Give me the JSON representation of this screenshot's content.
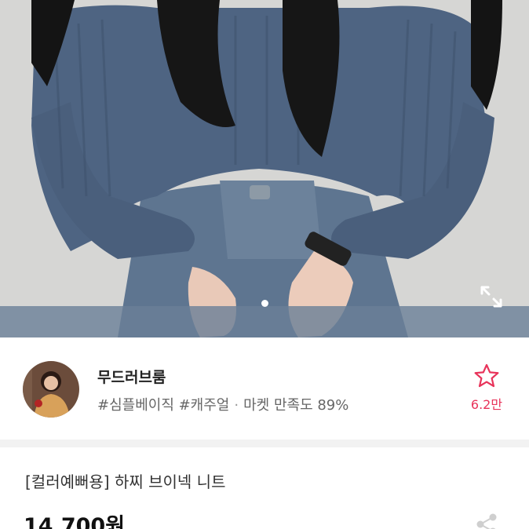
{
  "product_image": {
    "alt": "",
    "slide_count": 1,
    "active_slide": 1
  },
  "seller": {
    "name": "무드러브룸",
    "tags": "#심플베이직 #캐주얼",
    "separator": "·",
    "satisfaction": "마켓 만족도 89%"
  },
  "favorite": {
    "count": "6.2만",
    "icon": "star-outline-icon",
    "color": "#e8335a"
  },
  "product": {
    "title": "[컬러예뻐용] 하찌 브이넥 니트",
    "price": "14,700원"
  },
  "icons": {
    "expand": "expand-icon",
    "share": "share-icon"
  }
}
